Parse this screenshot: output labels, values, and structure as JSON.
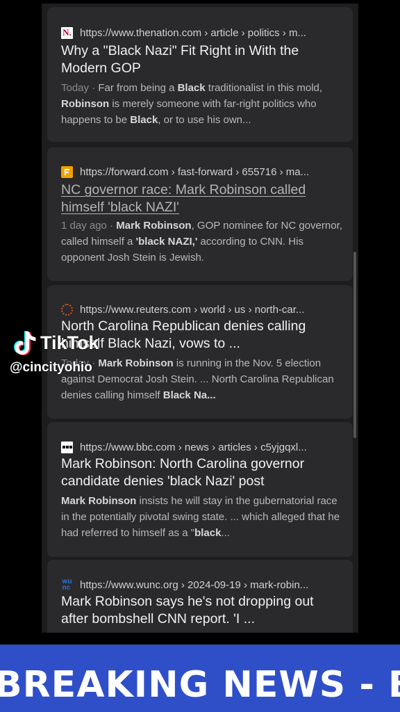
{
  "results": [
    {
      "url": "https://www.thenation.com › article › politics › m...",
      "favicon": "the-nation-icon",
      "favicon_text": "N.",
      "title": "Why a \"Black Nazi\" Fit Right in With the Modern GOP",
      "visited": false,
      "date": "Today",
      "snippet_parts": [
        {
          "t": "Far from being a ",
          "b": false
        },
        {
          "t": "Black",
          "b": true
        },
        {
          "t": " traditionalist in this mold, ",
          "b": false
        },
        {
          "t": "Robinson",
          "b": true
        },
        {
          "t": " is merely someone with far-right politics who happens to be ",
          "b": false
        },
        {
          "t": "Black",
          "b": true
        },
        {
          "t": ", or to use his own...",
          "b": false
        }
      ]
    },
    {
      "url": "https://forward.com › fast-forward › 655716 › ma...",
      "favicon": "forward-icon",
      "title": "NC governor race: Mark Robinson called himself 'black NAZI'",
      "visited": true,
      "date": "1 day ago",
      "snippet_parts": [
        {
          "t": "Mark Robinson",
          "b": true
        },
        {
          "t": ", GOP nominee for NC governor, called himself a ",
          "b": false
        },
        {
          "t": "'black NAZI,'",
          "b": true
        },
        {
          "t": " according to CNN. His opponent Josh Stein is Jewish.",
          "b": false
        }
      ]
    },
    {
      "url": "https://www.reuters.com › world › us › north-car...",
      "favicon": "reuters-icon",
      "title": "North Carolina Republican denies calling himself Black Nazi, vows to ...",
      "visited": false,
      "date": "Today",
      "snippet_parts": [
        {
          "t": "Mark Robinson",
          "b": true
        },
        {
          "t": " is running in the Nov. 5 election against Democrat Josh Stein. ... North Carolina Republican denies calling himself ",
          "b": false
        },
        {
          "t": "Black Na...",
          "b": true
        }
      ]
    },
    {
      "url": "https://www.bbc.com › news › articles › c5yjgqxl...",
      "favicon": "bbc-icon",
      "title": "Mark Robinson: North Carolina governor candidate denies 'black Nazi' post",
      "visited": false,
      "date": "",
      "snippet_parts": [
        {
          "t": "Mark Robinson",
          "b": true
        },
        {
          "t": " insists he will stay in the gubernatorial race in the potentially pivotal swing state. ... which alleged that he had referred to himself as a \"",
          "b": false
        },
        {
          "t": "black",
          "b": true
        },
        {
          "t": "...",
          "b": false
        }
      ]
    },
    {
      "url": "https://www.wunc.org › 2024-09-19 › mark-robin...",
      "favicon": "wunc-icon",
      "favicon_text": "wu\nnc",
      "title": "Mark Robinson says he's not dropping out after bombshell CNN report. 'I ...",
      "visited": false,
      "date": "",
      "snippet_parts": []
    }
  ],
  "overlay": {
    "brand": "TikTok",
    "handle": "@cincityohio"
  },
  "banner": {
    "text": "BREAKING NEWS - BREAKING NEWS",
    "color": "#2f4fc9"
  }
}
